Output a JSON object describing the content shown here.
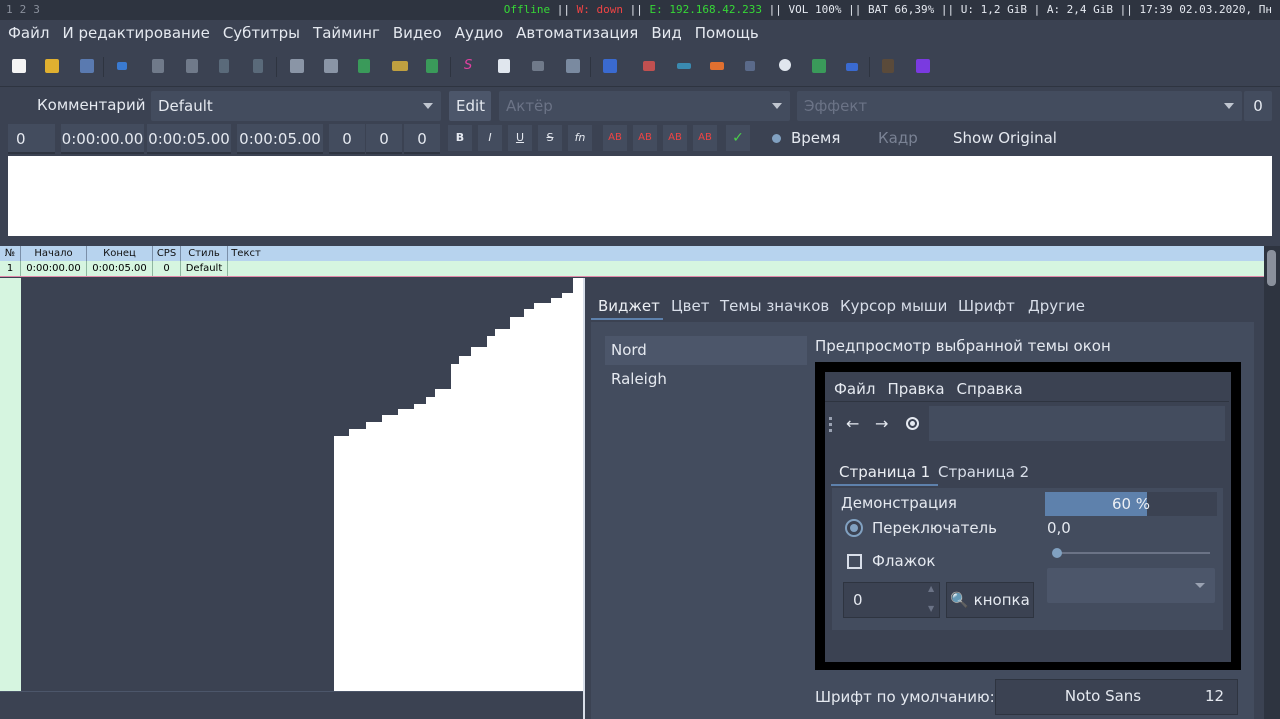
{
  "statusbar": {
    "workspaces": [
      "1",
      "2",
      "3"
    ],
    "offline": "Offline",
    "sep1": "||",
    "wifi": "W: down",
    "sep2": "||",
    "ethernet": "E: 192.168.42.233",
    "rest": "|| VOL 100% || BAT 66,39% || U: 1,2 GiB | A: 2,4 GiB || 17:39 02.03.2020, Пн"
  },
  "menu": [
    "Файл",
    "И редактирование",
    "Субтитры",
    "Тайминг",
    "Видео",
    "Аудио",
    "Автоматизация",
    "Вид",
    "Помощь"
  ],
  "editbox": {
    "comment_label": "Комментарий",
    "style": "Default",
    "edit_label": "Edit",
    "actor_placeholder": "Актёр",
    "effect_placeholder": "Эффект",
    "margin_value": "0",
    "layer": "0",
    "start": "0:00:00.00",
    "end": "0:00:05.00",
    "duration": "0:00:05.00",
    "margin_l": "0",
    "margin_r": "0",
    "margin_v": "0",
    "fmt_bold": "B",
    "fmt_italic": "I",
    "fmt_underline": "U",
    "fmt_strike": "S",
    "fmt_fn": "fn",
    "fmt_ab": "AB",
    "commit": "✓",
    "time_label": "Время",
    "frame_label": "Кадр",
    "show_original": "Show Original"
  },
  "grid": {
    "headers": [
      "№",
      "Начало",
      "Конец",
      "CPS",
      "Стиль",
      "Текст"
    ],
    "rows": [
      [
        "1",
        "0:00:00.00",
        "0:00:05.00",
        "0",
        "Default",
        ""
      ]
    ]
  },
  "settings": {
    "tabs": [
      "Виджет",
      "Цвет",
      "Темы значков",
      "Курсор мыши",
      "Шрифт",
      "Другие"
    ],
    "themes": [
      "Nord",
      "Raleigh"
    ],
    "preview_title": "Предпросмотр выбранной темы окон",
    "preview": {
      "menu": [
        "Файл",
        "Правка",
        "Справка"
      ],
      "tabs": [
        "Страница 1",
        "Страница 2"
      ],
      "demo_label": "Демонстрация",
      "radio_label": "Переключатель",
      "check_label": "Флажок",
      "spin_value": "0",
      "button_label": "кнопка",
      "progress_text": "60 %",
      "progress": 0.6,
      "value_text": "0,0",
      "slider": 0.0
    },
    "font_label": "Шрифт по умолчанию:",
    "font_name": "Noto Sans",
    "font_size": "12"
  }
}
